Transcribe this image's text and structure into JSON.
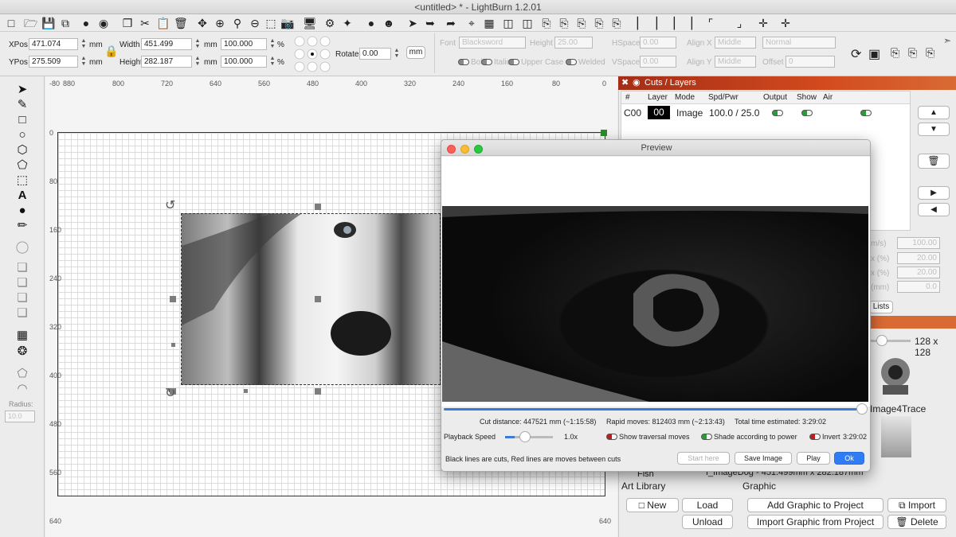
{
  "window": {
    "title": "<untitled> * - LightBurn 1.2.01"
  },
  "position": {
    "xpos_label": "XPos",
    "xpos": "471.074",
    "ypos_label": "YPos",
    "ypos": "275.509",
    "unit": "mm"
  },
  "size": {
    "width_label": "Width",
    "width": "451.499",
    "height_label": "Height",
    "height": "282.187",
    "unit": "mm"
  },
  "scale": {
    "x": "100.000",
    "y": "100.000",
    "unit": "%"
  },
  "rotate": {
    "label": "Rotate",
    "value": "0.00",
    "units_button": "mm"
  },
  "text_props": {
    "font_label": "Font",
    "font": "Blacksword",
    "height_label": "Height",
    "height": "25.00",
    "hspace_label": "HSpace",
    "hspace": "0.00",
    "vspace_label": "VSpace",
    "vspace": "0.00",
    "alignx_label": "Align X",
    "alignx": "Middle",
    "aligny_label": "Align Y",
    "aligny": "Middle",
    "normal": "Normal",
    "offset_label": "Offset",
    "offset": "0",
    "bold": "Bold",
    "italic": "Italic",
    "upper_case": "Upper Case",
    "welded": "Welded"
  },
  "rulers": {
    "top": [
      "-80",
      "880",
      "800",
      "720",
      "640",
      "560",
      "480",
      "400",
      "320",
      "240",
      "160",
      "80",
      "0"
    ],
    "left": [
      "0",
      "80",
      "160",
      "240",
      "320",
      "400",
      "480",
      "560",
      "640"
    ],
    "bottom_right": "640",
    "radius_label": "Radius:",
    "radius": "10.0"
  },
  "cuts": {
    "title": "Cuts / Layers",
    "headers": [
      "#",
      "Layer",
      "Mode",
      "Spd/Pwr",
      "Output",
      "Show",
      "Air"
    ],
    "row": {
      "num": "C00",
      "layer": "00",
      "mode": "Image",
      "spdpwr": "100.0 / 25.0"
    }
  },
  "hidden_values": {
    "v1": "100.00",
    "v2": "20.00",
    "v3": "20.00",
    "v4": "0.0",
    "l1": "m/s)",
    "l2": "x (%)",
    "l3": "x (%)",
    "l4": "(mm)",
    "list": "Lists",
    "size": "128 x 128"
  },
  "library": {
    "item_name": "Image4Trace",
    "row_partial": "Fish",
    "row_graphic": "f_ImageDog - 451.499mm x 282.187mm",
    "art_library": "Art Library",
    "graphic": "Graphic",
    "new": "New",
    "load": "Load",
    "unload": "Unload",
    "add_graphic": "Add Graphic to Project",
    "import_graphic": "Import Graphic from Project",
    "import": "Import",
    "delete": "Delete"
  },
  "preview": {
    "title": "Preview",
    "cut_distance": "Cut distance: 447521 mm (~1:15:58)",
    "rapid_moves": "Rapid moves: 812403 mm (~2:13:43)",
    "total_time": "Total time estimated: 3:29:02",
    "playback_label": "Playback Speed",
    "speed": "1.0x",
    "show_traversal": "Show traversal moves",
    "shade_power": "Shade according to power",
    "invert": "Invert",
    "invert_time": "3:29:02",
    "legend": "Black lines are cuts, Red lines are moves between cuts",
    "start_here": "Start here",
    "save_image": "Save Image",
    "play": "Play",
    "ok": "Ok",
    "progress": 1.0,
    "playback_speed_level": 0.2
  }
}
